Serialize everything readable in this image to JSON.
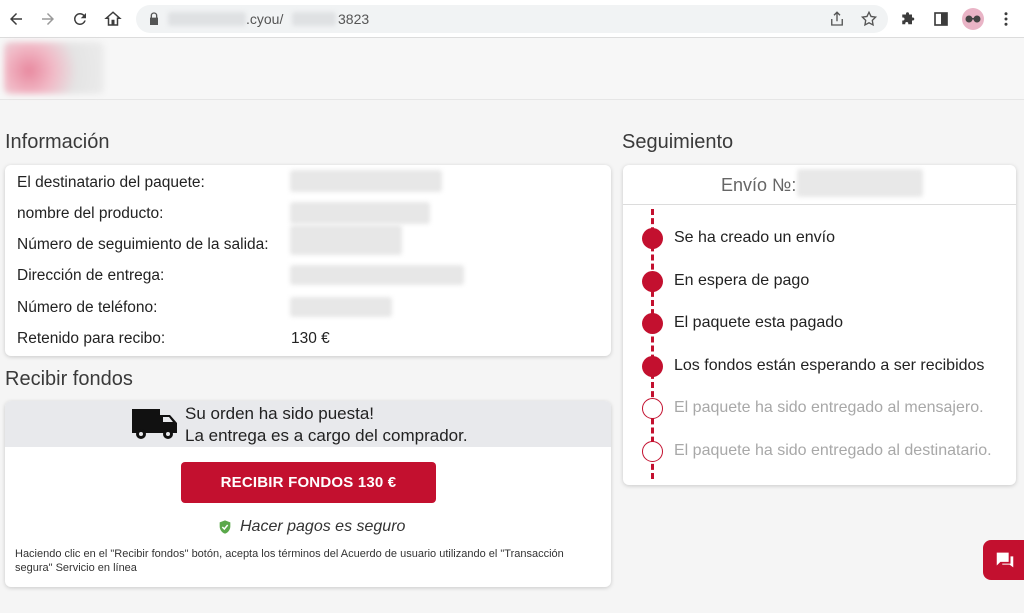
{
  "browser": {
    "url_domain": ".cyou/",
    "url_suffix": "3823"
  },
  "info": {
    "title": "Información",
    "rows": [
      {
        "label": "El destinatario del paquete:"
      },
      {
        "label": "nombre del producto:"
      },
      {
        "label": "Número de seguimiento de la salida:"
      },
      {
        "label": "Dirección de entrega:"
      },
      {
        "label": "Número de teléfono:"
      },
      {
        "label": "Retenido para recibo:",
        "value": "130 €"
      }
    ]
  },
  "funds": {
    "title": "Recibir fondos",
    "line1": "Su orden ha sido puesta!",
    "line2": "La entrega es a cargo del comprador.",
    "button_label": "RECIBIR FONDOS 130 €",
    "secure_label": "Hacer pagos es seguro",
    "terms": "Haciendo clic en el \"Recibir fondos\" botón, acepta los términos del Acuerdo de usuario utilizando el \"Transacción segura\" Servicio en línea"
  },
  "tracking": {
    "title": "Seguimiento",
    "shipment_label": "Envío №:",
    "steps": [
      {
        "label": "Se ha creado un envío",
        "done": true
      },
      {
        "label": "En espera de pago",
        "done": true
      },
      {
        "label": "El paquete esta pagado",
        "done": true
      },
      {
        "label": "Los fondos están esperando a ser recibidos",
        "done": true
      },
      {
        "label": "El paquete ha sido entregado al mensajero.",
        "done": false
      },
      {
        "label": "El paquete ha sido entregado al destinatario.",
        "done": false
      }
    ]
  },
  "colors": {
    "accent": "#c3102f",
    "pending_text": "#a8a8a8",
    "secure_check": "#5aa84a"
  },
  "icons": {
    "back": "arrow-left-icon",
    "forward": "arrow-right-icon",
    "reload": "reload-icon",
    "home": "home-icon",
    "lock": "lock-icon",
    "share": "share-icon",
    "bookmark": "star-icon",
    "extensions": "puzzle-icon",
    "sidepanel": "side-panel-icon",
    "menu": "kebab-menu-icon",
    "truck": "truck-icon",
    "secure": "shield-check-icon",
    "chat": "chat-icon"
  }
}
